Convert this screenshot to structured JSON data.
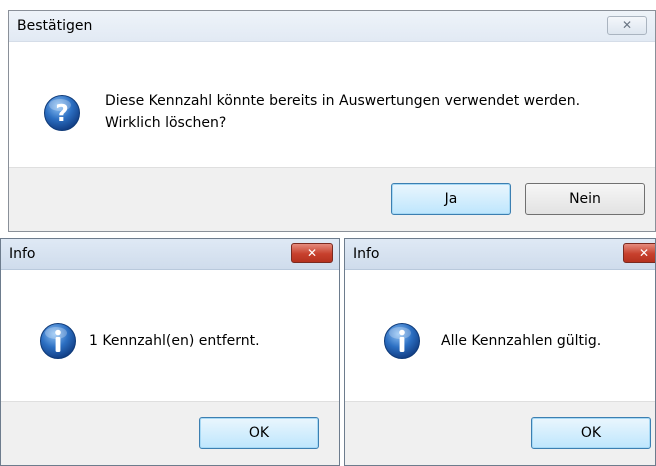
{
  "confirm_dialog": {
    "title": "Bestätigen",
    "close_glyph": "✕",
    "message_line1": "Diese Kennzahl könnte bereits in Auswertungen verwendet werden.",
    "message_line2": "Wirklich löschen?",
    "icon": "question-icon",
    "buttons": {
      "yes": "Ja",
      "no": "Nein"
    }
  },
  "info_dialog_removed": {
    "title": "Info",
    "close_glyph": "✕",
    "message": "1 Kennzahl(en) entfernt.",
    "icon": "info-icon",
    "ok_label": "OK"
  },
  "info_dialog_valid": {
    "title": "Info",
    "close_glyph": "✕",
    "message": "Alle Kennzahlen gültig.",
    "icon": "info-icon",
    "ok_label": "OK"
  },
  "colors": {
    "titlebar_inactive": "#e9f0f8",
    "titlebar_active": "#dbe7f4",
    "close_button_red": "#c7402d",
    "default_button_border": "#3c7fb1",
    "icon_blue": "#1f5fb3"
  }
}
